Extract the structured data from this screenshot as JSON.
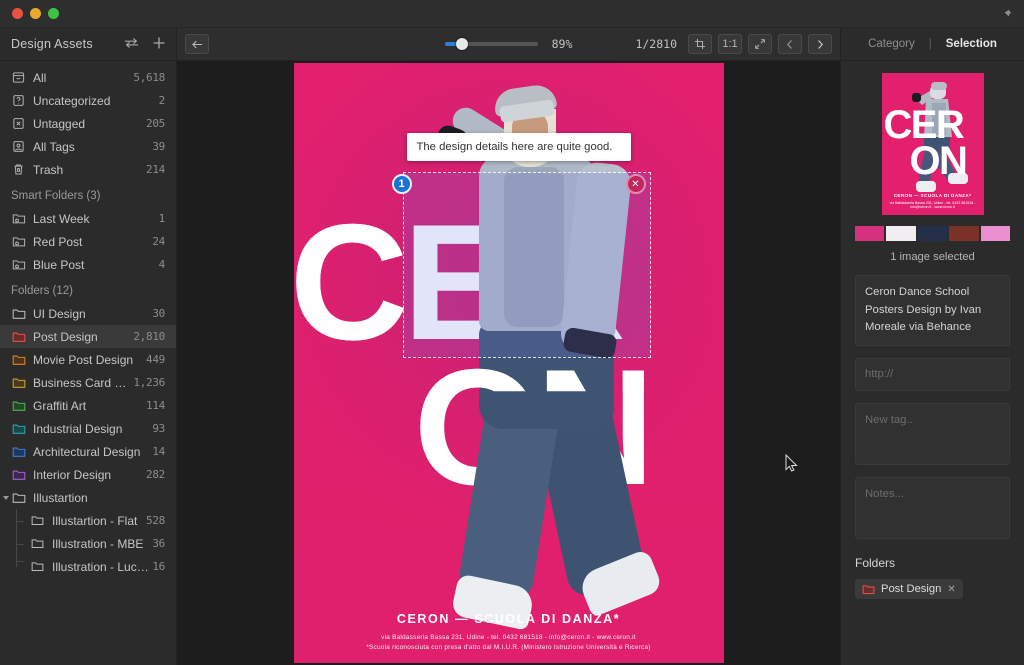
{
  "window": {
    "pin_icon": "pin-icon",
    "traffic_lights": [
      "close",
      "minimize",
      "maximize"
    ]
  },
  "sidebar": {
    "title": "Design Assets",
    "sort_icon": "sort-swap-icon",
    "add_icon": "plus-icon",
    "library": [
      {
        "label": "All",
        "count": "5,618",
        "icon": "all-icon"
      },
      {
        "label": "Uncategorized",
        "count": "2",
        "icon": "uncategorized-icon"
      },
      {
        "label": "Untagged",
        "count": "205",
        "icon": "untagged-icon"
      },
      {
        "label": "All Tags",
        "count": "39",
        "icon": "tags-icon"
      },
      {
        "label": "Trash",
        "count": "214",
        "icon": "trash-icon"
      }
    ],
    "smart_folders_title": "Smart Folders (3)",
    "smart_folders": [
      {
        "label": "Last Week",
        "count": "1"
      },
      {
        "label": "Red Post",
        "count": "24"
      },
      {
        "label": "Blue Post",
        "count": "4"
      }
    ],
    "folders_title": "Folders (12)",
    "folders": [
      {
        "label": "UI Design",
        "count": "30",
        "color": "#b9b9b9",
        "selected": false
      },
      {
        "label": "Post Design",
        "count": "2,810",
        "color": "#e0514a",
        "selected": true
      },
      {
        "label": "Movie Post Design",
        "count": "449",
        "color": "#d98128",
        "selected": false
      },
      {
        "label": "Business Card Design",
        "count": "1,236",
        "color": "#c9a12c",
        "selected": false
      },
      {
        "label": "Graffiti Art",
        "count": "114",
        "color": "#4cb14f",
        "selected": false
      },
      {
        "label": "Industrial Design",
        "count": "93",
        "color": "#2ba6a6",
        "selected": false
      },
      {
        "label": "Architectural Design",
        "count": "14",
        "color": "#3b7fd4",
        "selected": false
      },
      {
        "label": "Interior Design",
        "count": "282",
        "color": "#a05fd0",
        "selected": false
      }
    ],
    "tree": {
      "parent": {
        "label": "Illustartion",
        "count": ""
      },
      "children": [
        {
          "label": "Illustartion - Flat",
          "count": "528"
        },
        {
          "label": "Illustration - MBE",
          "count": "36"
        },
        {
          "label": "Illustration - Luca...",
          "count": "16"
        }
      ]
    }
  },
  "toolbar": {
    "back_icon": "arrow-left-icon",
    "zoom_percent": "89%",
    "counter": "1/2810",
    "crop_icon": "crop-icon",
    "actual_size_label": "1:1",
    "fit_icon": "fit-screen-icon",
    "prev_icon": "chevron-left-icon",
    "next_icon": "chevron-right-icon"
  },
  "poster": {
    "word_top": "CER",
    "word_bottom": "ON",
    "footer_title": "CERON — SCUOLA DI DANZA*",
    "footer_line1": "via Baldasseria Bassa 231, Udine - tel. 0432 681518 - info@ceron.it - www.ceron.it",
    "footer_line2": "*Scuola riconosciuta con presa d'atto dal M.I.U.R. (Ministero Istruzione Università e Ricerca)"
  },
  "annotation": {
    "text": "The design details here are quite good.",
    "pin_number": "1",
    "close_icon": "close-icon"
  },
  "right_panel": {
    "tab_category": "Category",
    "tab_divider": "|",
    "tab_selection": "Selection",
    "selection_count": "1 image selected",
    "palette": [
      "#d6317f",
      "#f0eef0",
      "#252f4a",
      "#7a3228",
      "#ea8fd0"
    ],
    "description": "Ceron Dance School Posters Design by Ivan Moreale via Behance",
    "url_placeholder": "http://",
    "tag_placeholder": "New tag..",
    "notes_placeholder": "Notes...",
    "folders_title": "Folders",
    "folder_chip": {
      "label": "Post Design",
      "color": "#e0514a",
      "remove_icon": "close-icon"
    }
  }
}
